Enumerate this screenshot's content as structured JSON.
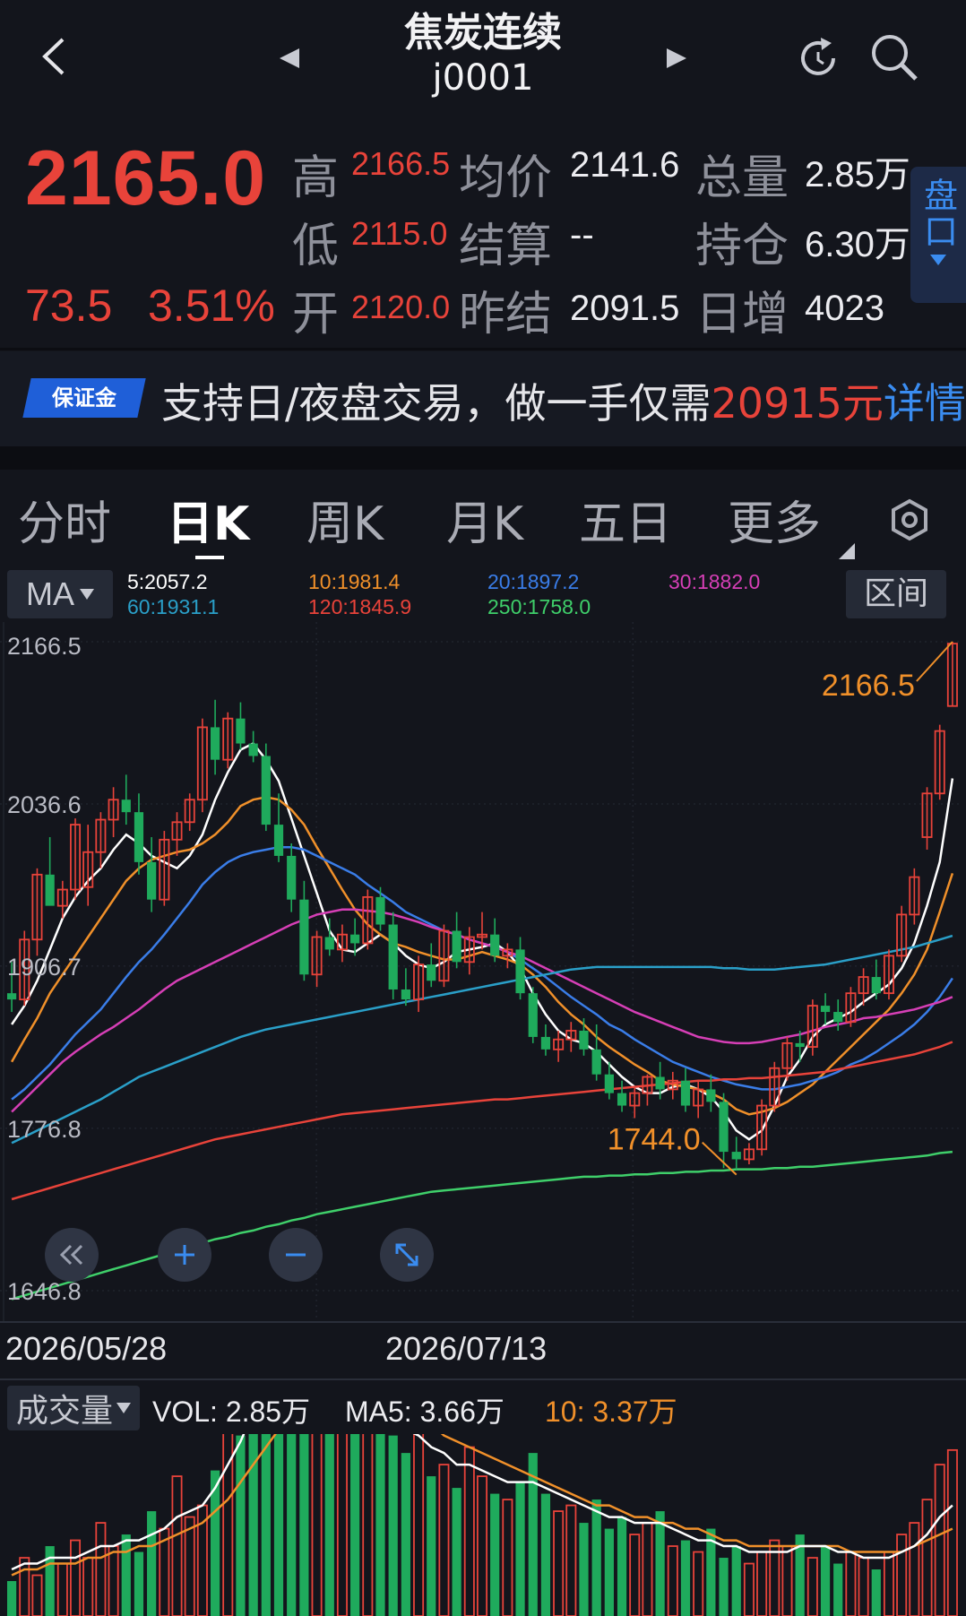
{
  "header": {
    "title": "焦炭连续",
    "code": "j0001"
  },
  "quote": {
    "last": "2165.0",
    "change": "73.5",
    "change_pct": "3.51%",
    "stats": [
      {
        "label": "高",
        "value": "2166.5"
      },
      {
        "label": "低",
        "value": "2115.0"
      },
      {
        "label": "开",
        "value": "2120.0"
      },
      {
        "label": "均价",
        "value": "2141.6"
      },
      {
        "label": "结算",
        "value": "--"
      },
      {
        "label": "昨结",
        "value": "2091.5"
      },
      {
        "label": "总量",
        "value": "2.85万"
      },
      {
        "label": "持仓",
        "value": "6.30万"
      },
      {
        "label": "日增",
        "value": "4023"
      }
    ],
    "side_tab": "盘口"
  },
  "banner": {
    "badge": "保证金",
    "text": "支持日/夜盘交易，做一手仅需",
    "highlight": "20915元",
    "more": "详情"
  },
  "tabs": [
    "分时",
    "日K",
    "周K",
    "月K",
    "五日",
    "更多"
  ],
  "ma_bar": {
    "selector": "MA",
    "range_button": "区间",
    "items": [
      {
        "text": "5:2057.2",
        "color": "#ffffff"
      },
      {
        "text": "10:1981.4",
        "color": "#f0902a"
      },
      {
        "text": "20:1897.2",
        "color": "#3a7de8"
      },
      {
        "text": "30:1882.0",
        "color": "#d63fb6"
      },
      {
        "text": "60:1931.1",
        "color": "#2a9fc8"
      },
      {
        "text": "120:1845.9",
        "color": "#e8433a"
      },
      {
        "text": "250:1758.0",
        "color": "#3fcf6a"
      }
    ]
  },
  "chart_data": {
    "type": "candlestick",
    "y_ticks": [
      "2166.5",
      "2036.6",
      "1906.7",
      "1776.8",
      "1646.8"
    ],
    "ylim": [
      1646.8,
      2166.5
    ],
    "x_ticks": [
      "2026/05/28",
      "2026/07/13"
    ],
    "annotations": {
      "high": "2166.5",
      "low": "1744.0"
    },
    "candles": [
      [
        1885,
        1910,
        1870,
        1880
      ],
      [
        1880,
        1935,
        1875,
        1928
      ],
      [
        1928,
        1985,
        1915,
        1980
      ],
      [
        1980,
        2010,
        1960,
        1955
      ],
      [
        1955,
        1975,
        1945,
        1968
      ],
      [
        1968,
        2025,
        1960,
        2020
      ],
      [
        1970,
        2020,
        1955,
        1998
      ],
      [
        1998,
        2030,
        1985,
        2024
      ],
      [
        2024,
        2050,
        2010,
        2040
      ],
      [
        2040,
        2060,
        2020,
        2030
      ],
      [
        2030,
        2045,
        1980,
        1990
      ],
      [
        1990,
        2010,
        1950,
        1960
      ],
      [
        1960,
        2015,
        1955,
        2008
      ],
      [
        2008,
        2030,
        1995,
        2022
      ],
      [
        2022,
        2045,
        2015,
        2040
      ],
      [
        2040,
        2105,
        2030,
        2098
      ],
      [
        2098,
        2120,
        2060,
        2072
      ],
      [
        2072,
        2110,
        2065,
        2105
      ],
      [
        2105,
        2118,
        2080,
        2085
      ],
      [
        2085,
        2095,
        2070,
        2075
      ],
      [
        2075,
        2085,
        2015,
        2020
      ],
      [
        2020,
        2045,
        1990,
        1995
      ],
      [
        1995,
        2005,
        1950,
        1960
      ],
      [
        1960,
        1975,
        1895,
        1900
      ],
      [
        1900,
        1935,
        1890,
        1930
      ],
      [
        1930,
        1945,
        1915,
        1920
      ],
      [
        1920,
        1940,
        1910,
        1932
      ],
      [
        1932,
        1945,
        1915,
        1925
      ],
      [
        1925,
        1968,
        1920,
        1962
      ],
      [
        1962,
        1970,
        1935,
        1940
      ],
      [
        1940,
        1950,
        1880,
        1888
      ],
      [
        1888,
        1905,
        1875,
        1880
      ],
      [
        1880,
        1915,
        1870,
        1908
      ],
      [
        1908,
        1925,
        1890,
        1895
      ],
      [
        1895,
        1940,
        1890,
        1935
      ],
      [
        1935,
        1950,
        1905,
        1910
      ],
      [
        1910,
        1938,
        1900,
        1930
      ],
      [
        1930,
        1950,
        1920,
        1932
      ],
      [
        1932,
        1945,
        1910,
        1915
      ],
      [
        1915,
        1925,
        1905,
        1920
      ],
      [
        1920,
        1930,
        1880,
        1885
      ],
      [
        1885,
        1890,
        1845,
        1850
      ],
      [
        1850,
        1860,
        1835,
        1840
      ],
      [
        1840,
        1855,
        1830,
        1848
      ],
      [
        1848,
        1862,
        1838,
        1855
      ],
      [
        1855,
        1865,
        1835,
        1840
      ],
      [
        1840,
        1860,
        1815,
        1820
      ],
      [
        1820,
        1830,
        1800,
        1805
      ],
      [
        1805,
        1815,
        1790,
        1795
      ],
      [
        1795,
        1810,
        1785,
        1805
      ],
      [
        1805,
        1820,
        1795,
        1818
      ],
      [
        1818,
        1830,
        1800,
        1808
      ],
      [
        1808,
        1822,
        1800,
        1815
      ],
      [
        1815,
        1825,
        1790,
        1795
      ],
      [
        1795,
        1815,
        1785,
        1808
      ],
      [
        1808,
        1820,
        1790,
        1798
      ],
      [
        1798,
        1805,
        1745,
        1758
      ],
      [
        1758,
        1770,
        1744,
        1752
      ],
      [
        1752,
        1765,
        1748,
        1760
      ],
      [
        1760,
        1800,
        1755,
        1795
      ],
      [
        1795,
        1830,
        1790,
        1825
      ],
      [
        1825,
        1850,
        1815,
        1845
      ],
      [
        1845,
        1855,
        1830,
        1842
      ],
      [
        1842,
        1880,
        1835,
        1875
      ],
      [
        1875,
        1885,
        1860,
        1870
      ],
      [
        1870,
        1880,
        1855,
        1862
      ],
      [
        1862,
        1890,
        1858,
        1885
      ],
      [
        1885,
        1905,
        1875,
        1898
      ],
      [
        1898,
        1912,
        1880,
        1885
      ],
      [
        1885,
        1920,
        1880,
        1915
      ],
      [
        1915,
        1955,
        1910,
        1948
      ],
      [
        1948,
        1985,
        1940,
        1978
      ],
      [
        2010,
        2050,
        2000,
        2045
      ],
      [
        2045,
        2100,
        2040,
        2095
      ],
      [
        2115,
        2166.5,
        2115,
        2165
      ]
    ],
    "ma_lines": [
      {
        "name": "MA5",
        "color": "#ffffff",
        "values": [
          1860,
          1875,
          1895,
          1920,
          1945,
          1962,
          1975,
          1985,
          2000,
          2012,
          2005,
          1995,
          1990,
          1985,
          1995,
          2012,
          2040,
          2062,
          2080,
          2085,
          2072,
          2055,
          2025,
          1995,
          1965,
          1935,
          1920,
          1918,
          1925,
          1932,
          1925,
          1915,
          1908,
          1905,
          1910,
          1918,
          1920,
          1922,
          1925,
          1918,
          1905,
          1885,
          1868,
          1855,
          1848,
          1845,
          1838,
          1828,
          1818,
          1810,
          1805,
          1805,
          1810,
          1812,
          1808,
          1802,
          1790,
          1775,
          1768,
          1775,
          1795,
          1818,
          1832,
          1850,
          1860,
          1865,
          1870,
          1878,
          1885,
          1892,
          1905,
          1925,
          1955,
          1990,
          2057
        ]
      },
      {
        "name": "MA10",
        "color": "#f0902a",
        "values": [
          1830,
          1848,
          1865,
          1885,
          1900,
          1915,
          1930,
          1945,
          1960,
          1975,
          1985,
          1992,
          1995,
          1998,
          2000,
          2005,
          2012,
          2022,
          2035,
          2040,
          2042,
          2040,
          2032,
          2020,
          2002,
          1985,
          1968,
          1952,
          1940,
          1932,
          1925,
          1922,
          1918,
          1915,
          1912,
          1912,
          1915,
          1918,
          1915,
          1912,
          1908,
          1900,
          1890,
          1878,
          1868,
          1860,
          1850,
          1842,
          1835,
          1828,
          1822,
          1815,
          1812,
          1810,
          1808,
          1805,
          1800,
          1792,
          1788,
          1790,
          1793,
          1798,
          1805,
          1812,
          1822,
          1832,
          1842,
          1852,
          1862,
          1872,
          1885,
          1900,
          1920,
          1950,
          1981
        ]
      },
      {
        "name": "MA20",
        "color": "#3a7de8",
        "values": [
          1800,
          1808,
          1818,
          1828,
          1840,
          1852,
          1862,
          1872,
          1885,
          1898,
          1910,
          1920,
          1932,
          1945,
          1958,
          1972,
          1982,
          1990,
          1995,
          1998,
          2000,
          2002,
          2002,
          2000,
          1995,
          1990,
          1985,
          1980,
          1972,
          1965,
          1958,
          1950,
          1945,
          1940,
          1935,
          1932,
          1928,
          1925,
          1922,
          1918,
          1912,
          1905,
          1898,
          1890,
          1882,
          1875,
          1868,
          1860,
          1855,
          1848,
          1842,
          1836,
          1830,
          1826,
          1822,
          1818,
          1815,
          1812,
          1810,
          1808,
          1808,
          1810,
          1812,
          1815,
          1818,
          1822,
          1828,
          1832,
          1838,
          1845,
          1852,
          1860,
          1870,
          1882,
          1897
        ]
      },
      {
        "name": "MA30",
        "color": "#d63fb6",
        "values": [
          1790,
          1800,
          1810,
          1820,
          1830,
          1838,
          1845,
          1852,
          1858,
          1865,
          1872,
          1880,
          1888,
          1895,
          1900,
          1905,
          1910,
          1915,
          1920,
          1925,
          1930,
          1935,
          1940,
          1944,
          1948,
          1950,
          1952,
          1952,
          1951,
          1950,
          1948,
          1945,
          1942,
          1938,
          1935,
          1932,
          1928,
          1925,
          1922,
          1918,
          1915,
          1910,
          1905,
          1900,
          1895,
          1890,
          1885,
          1880,
          1875,
          1870,
          1866,
          1862,
          1858,
          1854,
          1850,
          1848,
          1846,
          1845,
          1845,
          1846,
          1848,
          1850,
          1852,
          1855,
          1858,
          1860,
          1862,
          1865,
          1866,
          1868,
          1870,
          1872,
          1875,
          1878,
          1882
        ]
      },
      {
        "name": "MA60",
        "color": "#2a9fc8",
        "values": [
          1765,
          1770,
          1775,
          1780,
          1785,
          1790,
          1795,
          1800,
          1806,
          1812,
          1818,
          1822,
          1826,
          1830,
          1834,
          1838,
          1842,
          1846,
          1850,
          1853,
          1856,
          1858,
          1860,
          1862,
          1864,
          1866,
          1868,
          1870,
          1872,
          1874,
          1876,
          1878,
          1880,
          1882,
          1884,
          1886,
          1888,
          1890,
          1892,
          1894,
          1896,
          1898,
          1900,
          1902,
          1904,
          1905,
          1906,
          1906,
          1906,
          1906,
          1906,
          1906,
          1906,
          1906,
          1906,
          1906,
          1905,
          1905,
          1904,
          1904,
          1904,
          1905,
          1906,
          1907,
          1908,
          1910,
          1912,
          1914,
          1916,
          1918,
          1920,
          1922,
          1925,
          1928,
          1931
        ]
      },
      {
        "name": "MA120",
        "color": "#e8433a",
        "values": [
          1720,
          1723,
          1726,
          1729,
          1732,
          1735,
          1738,
          1741,
          1744,
          1747,
          1750,
          1753,
          1756,
          1759,
          1762,
          1765,
          1768,
          1770,
          1772,
          1774,
          1776,
          1778,
          1780,
          1782,
          1784,
          1786,
          1788,
          1789,
          1790,
          1791,
          1792,
          1793,
          1794,
          1795,
          1796,
          1797,
          1798,
          1799,
          1800,
          1800,
          1801,
          1802,
          1803,
          1804,
          1805,
          1806,
          1807,
          1808,
          1809,
          1810,
          1811,
          1812,
          1813,
          1814,
          1815,
          1815,
          1816,
          1816,
          1817,
          1817,
          1818,
          1819,
          1820,
          1821,
          1822,
          1824,
          1826,
          1828,
          1830,
          1832,
          1834,
          1836,
          1839,
          1842,
          1846
        ]
      },
      {
        "name": "MA250",
        "color": "#3fcf6a",
        "values": [
          1640,
          1643,
          1646,
          1649,
          1652,
          1655,
          1658,
          1661,
          1664,
          1667,
          1670,
          1673,
          1676,
          1679,
          1682,
          1685,
          1688,
          1690,
          1693,
          1695,
          1698,
          1700,
          1703,
          1705,
          1708,
          1710,
          1712,
          1714,
          1716,
          1718,
          1720,
          1722,
          1724,
          1726,
          1727,
          1728,
          1729,
          1730,
          1731,
          1732,
          1733,
          1734,
          1735,
          1736,
          1737,
          1738,
          1738,
          1739,
          1739,
          1740,
          1740,
          1741,
          1741,
          1742,
          1742,
          1743,
          1743,
          1744,
          1744,
          1744,
          1745,
          1745,
          1746,
          1746,
          1747,
          1748,
          1749,
          1750,
          1751,
          1752,
          1753,
          1754,
          1755,
          1757,
          1758
        ]
      }
    ]
  },
  "volume": {
    "selector": "成交量",
    "vol": "VOL: 2.85万",
    "ma5": "MA5: 3.66万",
    "ma10": "10: 3.37万",
    "ylim": [
      0,
      10
    ],
    "bars": [
      0.6,
      1.0,
      0.7,
      1.2,
      0.9,
      1.3,
      1.0,
      1.6,
      1.2,
      1.4,
      1.1,
      1.8,
      1.5,
      2.4,
      1.7,
      1.9,
      2.5,
      3.8,
      3.1,
      4.5,
      4.9,
      3.6,
      5.2,
      4.0,
      4.3,
      5.6,
      4.1,
      3.4,
      3.8,
      3.2,
      3.1,
      2.8,
      3.3,
      2.4,
      2.6,
      2.2,
      2.9,
      2.4,
      2.1,
      2.0,
      2.3,
      2.8,
      2.1,
      1.8,
      1.9,
      1.6,
      2.0,
      1.5,
      1.7,
      1.4,
      1.6,
      1.8,
      1.2,
      1.3,
      1.1,
      1.5,
      1.0,
      1.2,
      0.9,
      1.1,
      1.3,
      1.2,
      1.4,
      1.0,
      1.2,
      0.9,
      1.1,
      1.0,
      0.8,
      1.1,
      1.4,
      1.6,
      2.0,
      2.6,
      2.85
    ],
    "ma5_line": [
      0.8,
      0.9,
      0.9,
      1.0,
      1.0,
      1.0,
      1.1,
      1.2,
      1.2,
      1.3,
      1.3,
      1.4,
      1.5,
      1.7,
      1.8,
      1.9,
      2.2,
      2.6,
      3.0,
      3.5,
      3.9,
      4.1,
      4.3,
      4.4,
      4.6,
      4.6,
      4.4,
      4.2,
      4.0,
      3.6,
      3.4,
      3.2,
      3.1,
      2.9,
      2.8,
      2.6,
      2.6,
      2.5,
      2.4,
      2.3,
      2.3,
      2.3,
      2.2,
      2.1,
      2.0,
      1.9,
      1.8,
      1.7,
      1.7,
      1.6,
      1.6,
      1.6,
      1.5,
      1.4,
      1.3,
      1.3,
      1.2,
      1.2,
      1.1,
      1.1,
      1.1,
      1.1,
      1.2,
      1.2,
      1.2,
      1.1,
      1.1,
      1.0,
      1.0,
      1.0,
      1.1,
      1.2,
      1.4,
      1.7,
      1.9
    ],
    "ma10_line": [
      0.7,
      0.8,
      0.8,
      0.9,
      0.9,
      0.9,
      1.0,
      1.0,
      1.1,
      1.1,
      1.2,
      1.2,
      1.3,
      1.4,
      1.5,
      1.6,
      1.8,
      2.0,
      2.3,
      2.6,
      2.9,
      3.2,
      3.5,
      3.7,
      3.9,
      4.1,
      4.2,
      4.2,
      4.1,
      4.0,
      3.8,
      3.6,
      3.5,
      3.3,
      3.1,
      3.0,
      2.9,
      2.8,
      2.7,
      2.6,
      2.5,
      2.4,
      2.3,
      2.2,
      2.1,
      2.0,
      1.9,
      1.9,
      1.8,
      1.7,
      1.7,
      1.6,
      1.6,
      1.5,
      1.5,
      1.4,
      1.3,
      1.3,
      1.2,
      1.2,
      1.2,
      1.2,
      1.2,
      1.2,
      1.2,
      1.2,
      1.1,
      1.1,
      1.1,
      1.1,
      1.1,
      1.2,
      1.3,
      1.4,
      1.5
    ]
  }
}
